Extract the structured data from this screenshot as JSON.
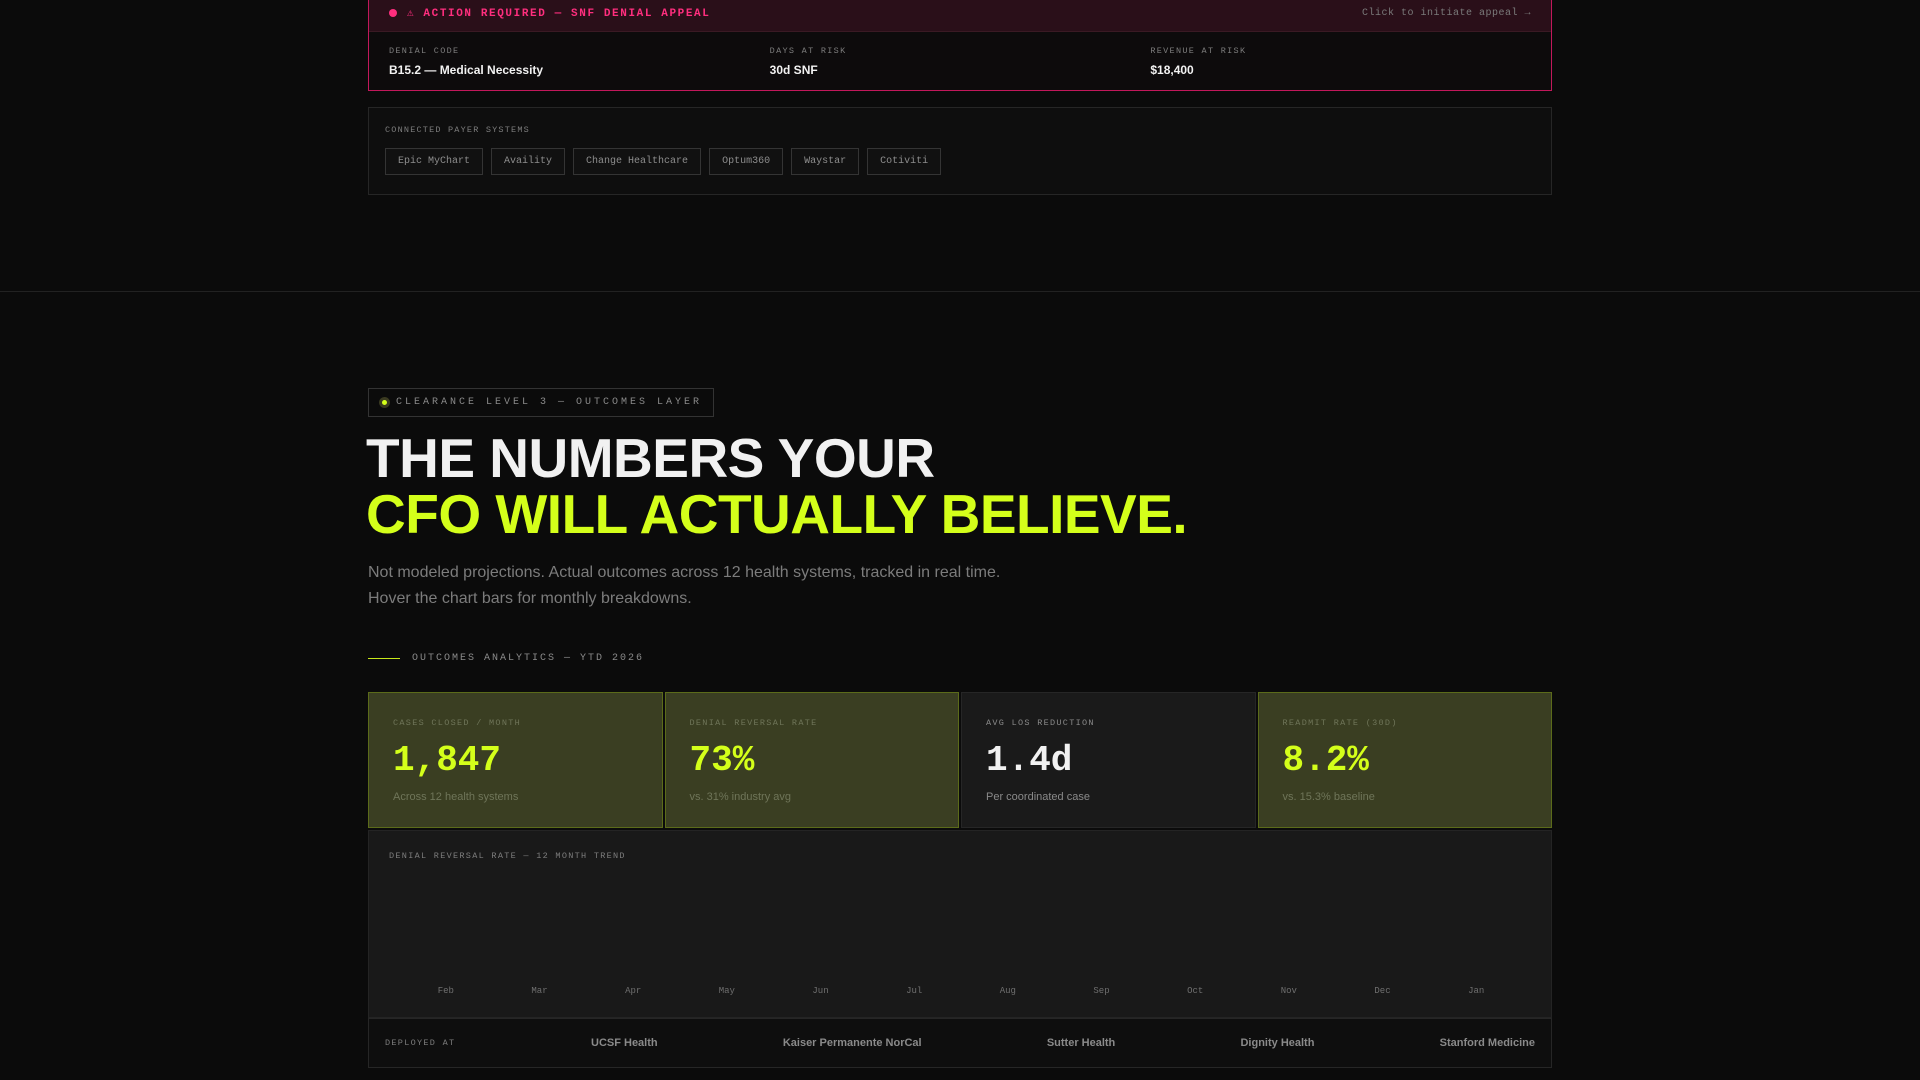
{
  "alert": {
    "title": "⚠ ACTION REQUIRED — SNF DENIAL APPEAL",
    "link": "Click to initiate appeal →",
    "fields": [
      {
        "label": "DENIAL CODE",
        "value": "B15.2 — Medical Necessity"
      },
      {
        "label": "DAYS AT RISK",
        "value": "30d SNF"
      },
      {
        "label": "REVENUE AT RISK",
        "value": "$18,400"
      }
    ],
    "accent": "#ff2e7e"
  },
  "payers": {
    "label": "CONNECTED PAYER SYSTEMS",
    "items": [
      "Epic MyChart",
      "Availity",
      "Change Healthcare",
      "Optum360",
      "Waystar",
      "Cotiviti"
    ]
  },
  "badge": "CLEARANCE LEVEL 3 — OUTCOMES LAYER",
  "headline": {
    "line1": "THE NUMBERS YOUR",
    "line2": "CFO WILL ACTUALLY BELIEVE."
  },
  "subtitle": {
    "line1": "Not modeled projections. Actual outcomes across 12 health systems, tracked in real time.",
    "line2": "Hover the chart bars for monthly breakdowns."
  },
  "analytics_label": "OUTCOMES ANALYTICS — YTD 2026",
  "stats": [
    {
      "label": "CASES CLOSED / MONTH",
      "value": "1,847",
      "note": "Across 12 health systems"
    },
    {
      "label": "DENIAL REVERSAL RATE",
      "value": "73%",
      "note": "vs. 31% industry avg"
    },
    {
      "label": "AVG LOS REDUCTION",
      "value": "1.4d",
      "note": "Per coordinated case"
    },
    {
      "label": "READMIT RATE (30D)",
      "value": "8.2%",
      "note": "vs. 15.3% baseline"
    }
  ],
  "chart_data": {
    "type": "bar",
    "title": "DENIAL REVERSAL RATE — 12 MONTH TREND",
    "categories": [
      "Feb",
      "Mar",
      "Apr",
      "May",
      "Jun",
      "Jul",
      "Aug",
      "Sep",
      "Oct",
      "Nov",
      "Dec",
      "Jan"
    ]
  },
  "deployed": {
    "label": "DEPLOYED AT",
    "orgs": [
      "UCSF Health",
      "Kaiser Permanente NorCal",
      "Sutter Health",
      "Dignity Health",
      "Stanford Medicine"
    ]
  },
  "colors": {
    "accent": "#d4ff1a",
    "alert": "#ff2e7e",
    "background": "#0b0b0b"
  }
}
